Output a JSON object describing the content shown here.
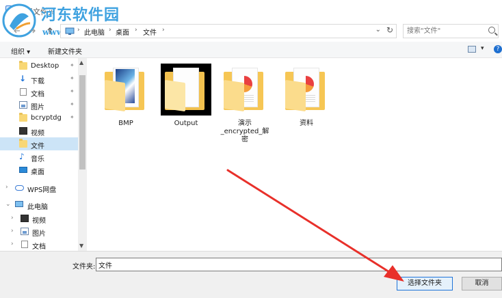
{
  "window": {
    "title": "选择文件夹"
  },
  "watermark": {
    "site_name": "河东软件园",
    "url": "www.pc0359.cn"
  },
  "address_bar": {
    "back_icon": "arrow-left-icon",
    "forward_icon": "arrow-right-icon",
    "up_icon": "arrow-up-icon",
    "crumbs": [
      "此电脑",
      "桌面",
      "文件"
    ],
    "separator": "›",
    "dropdown_glyph": "⌄",
    "refresh_glyph": "↻"
  },
  "search": {
    "placeholder": "搜索\"文件\""
  },
  "toolbar": {
    "organize_label": "组织 ▾",
    "new_folder_label": "新建文件夹",
    "view_dropdown_glyph": "▾",
    "help_glyph": "?"
  },
  "sidebar": {
    "pin_glyph": "✦",
    "items": [
      {
        "label": "Desktop",
        "icon": "folder-icon",
        "pinned": true
      },
      {
        "label": "下载",
        "icon": "download-icon",
        "pinned": true
      },
      {
        "label": "文档",
        "icon": "document-icon",
        "pinned": true
      },
      {
        "label": "图片",
        "icon": "picture-icon",
        "pinned": true
      },
      {
        "label": "bcryptdg",
        "icon": "folder-icon",
        "pinned": true
      },
      {
        "label": "视频",
        "icon": "video-icon",
        "pinned": false
      },
      {
        "label": "文件",
        "icon": "folder-icon",
        "pinned": false,
        "selected": true
      },
      {
        "label": "音乐",
        "icon": "music-icon",
        "pinned": false
      },
      {
        "label": "桌面",
        "icon": "desktop-icon",
        "pinned": false
      },
      {
        "label": "WPS网盘",
        "icon": "cloud-icon",
        "chevron": "›"
      },
      {
        "label": "此电脑",
        "icon": "computer-icon",
        "chevron": "⌄"
      },
      {
        "label": "视频",
        "icon": "video-icon",
        "chevron": "›"
      },
      {
        "label": "图片",
        "icon": "picture-icon",
        "chevron": "›"
      },
      {
        "label": "文档",
        "icon": "document-icon",
        "chevron": "›"
      }
    ]
  },
  "files": [
    {
      "name": "BMP",
      "icon": "folder-image-icon"
    },
    {
      "name": "Output",
      "icon": "folder-icon"
    },
    {
      "name": "演示_encrypted_解密",
      "icon": "folder-document-icon"
    },
    {
      "name": "资料",
      "icon": "folder-document-icon"
    }
  ],
  "bottom": {
    "folder_label": "文件夹:",
    "folder_value": "文件",
    "select_button": "选择文件夹",
    "cancel_button": "取消"
  },
  "colors": {
    "selection": "#cce4f7",
    "accent": "#1e73d8",
    "annotation_arrow": "#e8302a",
    "folder": "#f6c654"
  }
}
